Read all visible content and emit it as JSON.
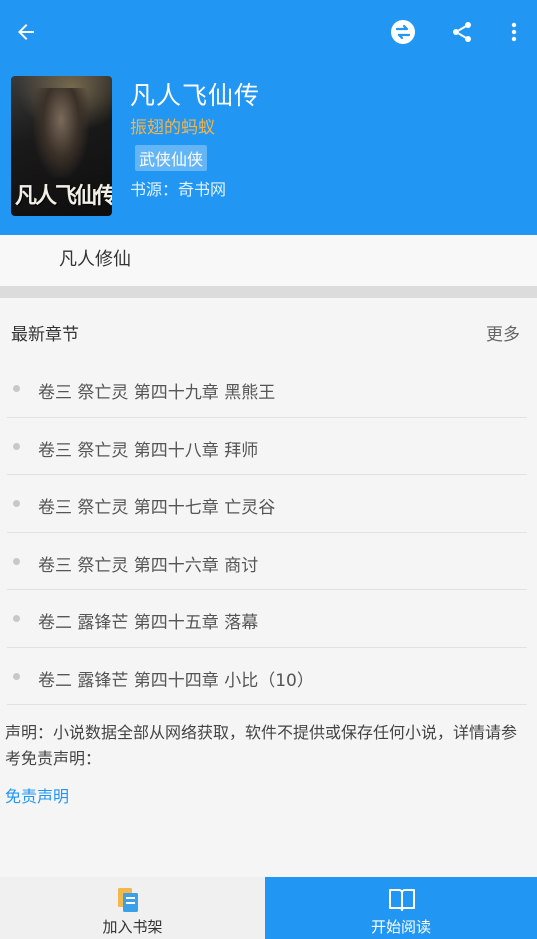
{
  "toolbar": {
    "back_icon": "arrow-left-icon",
    "swap_source_icon": "swap-source-icon",
    "share_icon": "share-icon",
    "more_icon": "more-vertical-icon"
  },
  "book": {
    "title": "凡人飞仙传",
    "author": "振翅的蚂蚁",
    "tag": "武侠仙侠",
    "source": "书源：奇书网",
    "intro": "凡人修仙"
  },
  "chapters": {
    "heading": "最新章节",
    "more_label": "更多",
    "items": [
      {
        "label": "卷三 祭亡灵 第四十九章 黑熊王"
      },
      {
        "label": "卷三 祭亡灵 第四十八章 拜师"
      },
      {
        "label": "卷三 祭亡灵 第四十七章 亡灵谷"
      },
      {
        "label": "卷三 祭亡灵 第四十六章 商讨"
      },
      {
        "label": "卷二 露锋芒 第四十五章 落幕"
      },
      {
        "label": "卷二 露锋芒 第四十四章 小比（10）"
      }
    ]
  },
  "disclaimer": {
    "text": "声明：小说数据全部从网络获取，软件不提供或保存任何小说，详情请参考免责声明：",
    "link": "免责声明"
  },
  "bottom_bar": {
    "add_shelf_label": "加入书架",
    "start_read_label": "开始阅读"
  },
  "colors": {
    "primary": "#2196f3",
    "author": "#f4b24a",
    "tag_bg": "#64b5f6"
  }
}
